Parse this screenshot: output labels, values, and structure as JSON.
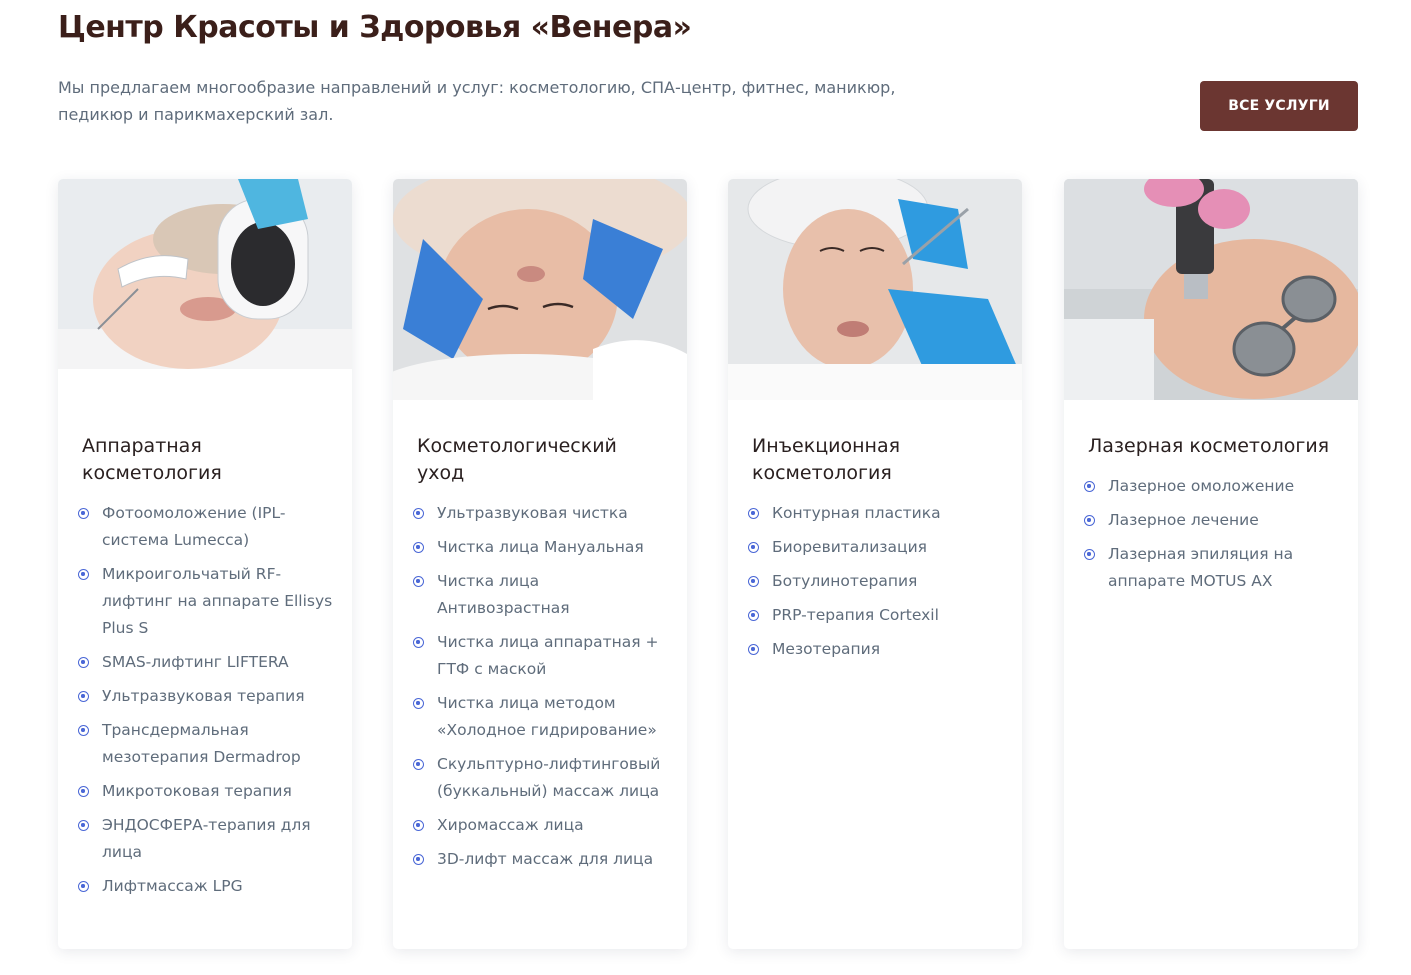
{
  "header": {
    "title": "Центр Красоты и Здоровья «Венера»",
    "description": "Мы предлагаем многообразие направлений и услуг: косметологию, СПА-центр, фитнес, маникюр, педикюр и парикмахерский зал.",
    "all_services_label": "ВСЕ УСЛУГИ"
  },
  "colors": {
    "title": "#3b1f1a",
    "button_bg": "#6b3631",
    "bullet": "#4a67d6",
    "text": "#5f6c7b"
  },
  "cards": [
    {
      "title": "Аппаратная косметология",
      "items": [
        "Фотоомоложение (IPL-система Lumecca)",
        "Микроигольчатый RF-лифтинг на аппарате Ellisys Plus S",
        "SMAS-лифтинг LIFTERA",
        "Ультразвуковая терапия",
        "Трансдермальная мезотерапия Dermadrop",
        "Микротоковая терапия",
        "ЭНДОСФЕРА-терапия для лица",
        "Лифтмассаж LPG"
      ]
    },
    {
      "title": "Косметологический уход",
      "items": [
        "Ультразвуковая чистка",
        "Чистка лица Мануальная",
        "Чистка лица Антивозрастная",
        "Чистка лица аппаратная + ГТФ с маской",
        "Чистка лица методом «Холодное гидрирование»",
        "Скульптурно-лифтинговый (буккальный) массаж лица",
        "Хиромассаж лица",
        "3D-лифт массаж для лица"
      ]
    },
    {
      "title": "Инъекционная косметология",
      "items": [
        "Контурная пластика",
        "Биоревитализация",
        "Ботулинотерапия",
        "PRP-терапия Cortexil",
        "Мезотерапия"
      ]
    },
    {
      "title": "Лазерная косметология",
      "items": [
        "Лазерное омоложение",
        "Лазерное лечение",
        "Лазерная эпиляция на аппарате MOTUS AX"
      ]
    }
  ]
}
